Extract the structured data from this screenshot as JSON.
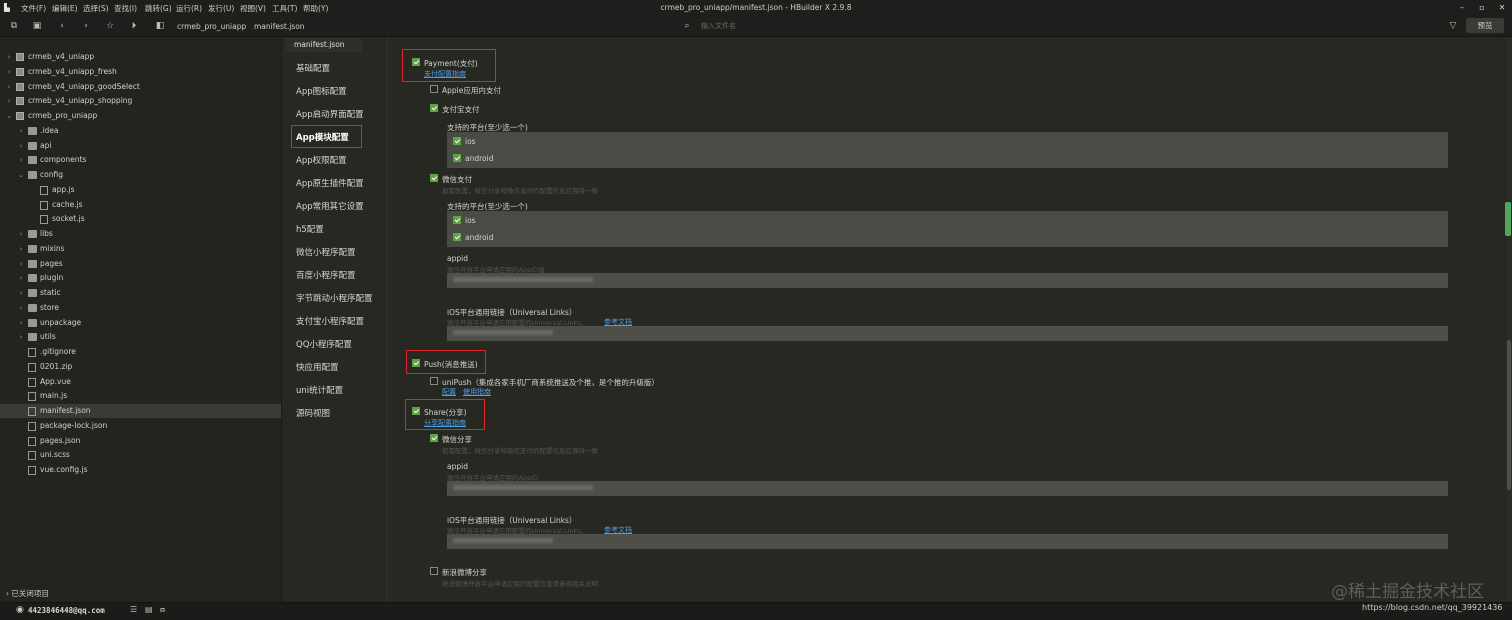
{
  "window": {
    "title": "crmeb_pro_uniapp/manifest.json - HBuilder X 2.9.8",
    "menus": [
      "文件(F)",
      "编辑(E)",
      "选择(S)",
      "查找(I)",
      "跳转(G)",
      "运行(R)",
      "发行(U)",
      "视图(V)",
      "工具(T)",
      "帮助(Y)"
    ],
    "controls": [
      "minimize-icon",
      "restore-icon",
      "close-icon"
    ]
  },
  "toolbar": {
    "breadcrumb": [
      "crmeb_pro_uniapp",
      "manifest.json"
    ],
    "file_search_placeholder": "输入文件名",
    "preview_label": "预览",
    "icons": [
      "new-file-icon",
      "save-icon",
      "back-icon",
      "forward-icon",
      "star-icon",
      "run-icon",
      "project-icon"
    ]
  },
  "sidebar": {
    "items": [
      {
        "label": "crmeb_v4_uniapp",
        "depth": 0,
        "kind": "project",
        "expanded": false
      },
      {
        "label": "crmeb_v4_uniapp_fresh",
        "depth": 0,
        "kind": "project",
        "expanded": false
      },
      {
        "label": "crmeb_v4_uniapp_goodSelect",
        "depth": 0,
        "kind": "project",
        "expanded": false
      },
      {
        "label": "crmeb_v4_uniapp_shopping",
        "depth": 0,
        "kind": "project",
        "expanded": false
      },
      {
        "label": "crmeb_pro_uniapp",
        "depth": 0,
        "kind": "project",
        "expanded": true
      },
      {
        "label": ".idea",
        "depth": 1,
        "kind": "folder",
        "expanded": false
      },
      {
        "label": "api",
        "depth": 1,
        "kind": "folder",
        "expanded": false
      },
      {
        "label": "components",
        "depth": 1,
        "kind": "folder",
        "expanded": false
      },
      {
        "label": "config",
        "depth": 1,
        "kind": "folder",
        "expanded": true
      },
      {
        "label": "app.js",
        "depth": 2,
        "kind": "file"
      },
      {
        "label": "cache.js",
        "depth": 2,
        "kind": "file"
      },
      {
        "label": "socket.js",
        "depth": 2,
        "kind": "file"
      },
      {
        "label": "libs",
        "depth": 1,
        "kind": "folder",
        "expanded": false
      },
      {
        "label": "mixins",
        "depth": 1,
        "kind": "folder",
        "expanded": false
      },
      {
        "label": "pages",
        "depth": 1,
        "kind": "folder",
        "expanded": false
      },
      {
        "label": "plugin",
        "depth": 1,
        "kind": "folder",
        "expanded": false
      },
      {
        "label": "static",
        "depth": 1,
        "kind": "folder",
        "expanded": false
      },
      {
        "label": "store",
        "depth": 1,
        "kind": "folder",
        "expanded": false
      },
      {
        "label": "unpackage",
        "depth": 1,
        "kind": "folder",
        "expanded": false
      },
      {
        "label": "utils",
        "depth": 1,
        "kind": "folder",
        "expanded": false
      },
      {
        "label": ".gitignore",
        "depth": 1,
        "kind": "file"
      },
      {
        "label": "0201.zip",
        "depth": 1,
        "kind": "file"
      },
      {
        "label": "App.vue",
        "depth": 1,
        "kind": "file"
      },
      {
        "label": "main.js",
        "depth": 1,
        "kind": "file"
      },
      {
        "label": "manifest.json",
        "depth": 1,
        "kind": "file",
        "selected": true
      },
      {
        "label": "package-lock.json",
        "depth": 1,
        "kind": "file"
      },
      {
        "label": "pages.json",
        "depth": 1,
        "kind": "file"
      },
      {
        "label": "uni.scss",
        "depth": 1,
        "kind": "file"
      },
      {
        "label": "vue.config.js",
        "depth": 1,
        "kind": "file"
      }
    ],
    "closed_projects": "已关闭项目"
  },
  "editor": {
    "tab": "manifest.json",
    "nav": [
      {
        "label": "基础配置"
      },
      {
        "label": "App图标配置"
      },
      {
        "label": "App启动界面配置"
      },
      {
        "label": "App模块配置",
        "active": true
      },
      {
        "label": "App权限配置"
      },
      {
        "label": "App原生插件配置"
      },
      {
        "label": "App常用其它设置"
      },
      {
        "label": "h5配置"
      },
      {
        "label": "微信小程序配置"
      },
      {
        "label": "百度小程序配置"
      },
      {
        "label": "字节跳动小程序配置"
      },
      {
        "label": "支付宝小程序配置"
      },
      {
        "label": "QQ小程序配置"
      },
      {
        "label": "快应用配置"
      },
      {
        "label": "uni统计配置"
      },
      {
        "label": "源码视图"
      }
    ]
  },
  "modules": {
    "payment": {
      "label": "Payment(支付)",
      "checked": true,
      "link": "支付配置指南",
      "apple": {
        "label": "Apple应用内支付",
        "checked": false
      },
      "alipay": {
        "label": "支付宝支付",
        "checked": true,
        "platform_title": "支持的平台(至少选一个)",
        "ios": {
          "label": "ios",
          "checked": true
        },
        "android": {
          "label": "android",
          "checked": true
        }
      },
      "wechat": {
        "label": "微信支付",
        "checked": true,
        "hint": "如需配置，微信分享和微信支付的配置信息应保持一致",
        "platform_title": "支持的平台(至少选一个)",
        "ios": {
          "label": "ios",
          "checked": true
        },
        "android": {
          "label": "android",
          "checked": true
        },
        "appid_label": "appid",
        "appid_hint": "微信开放平台申请应用的AppID值",
        "ulinks_label": "iOS平台通用链接（Universal Links）",
        "ulinks_hint": "微信开放平台申请应用配置的Universal Links。",
        "ulinks_link": "参考文档"
      }
    },
    "push": {
      "label": "Push(消息推送)",
      "checked": true,
      "unipush": {
        "label": "uniPush（集成各家手机厂商系统推送及个推，是个推的升级版）",
        "checked": false,
        "link_config": "配置",
        "link_guide": "使用指南"
      }
    },
    "share": {
      "label": "Share(分享)",
      "checked": true,
      "link": "分享配置指南",
      "wechat": {
        "label": "微信分享",
        "checked": true,
        "hint": "如需配置，微信分享和微信支付的配置信息应保持一致",
        "appid_label": "appid",
        "appid_hint": "微信开放平台申请应用的AppID",
        "ulinks_label": "iOS平台通用链接（Universal Links）",
        "ulinks_hint": "微信开放平台申请应用配置的Universal Links。",
        "ulinks_link": "参考文档"
      },
      "weibo": {
        "label": "新浪微博分享",
        "checked": false,
        "hint": "新浪微博开放平台申请应用的配置信息请参阅相关说明"
      }
    }
  },
  "statusbar": {
    "user": "4423846448@qq.com",
    "url": "https://blog.csdn.net/qq_39921436",
    "watermark": "@稀土掘金技术社区"
  }
}
